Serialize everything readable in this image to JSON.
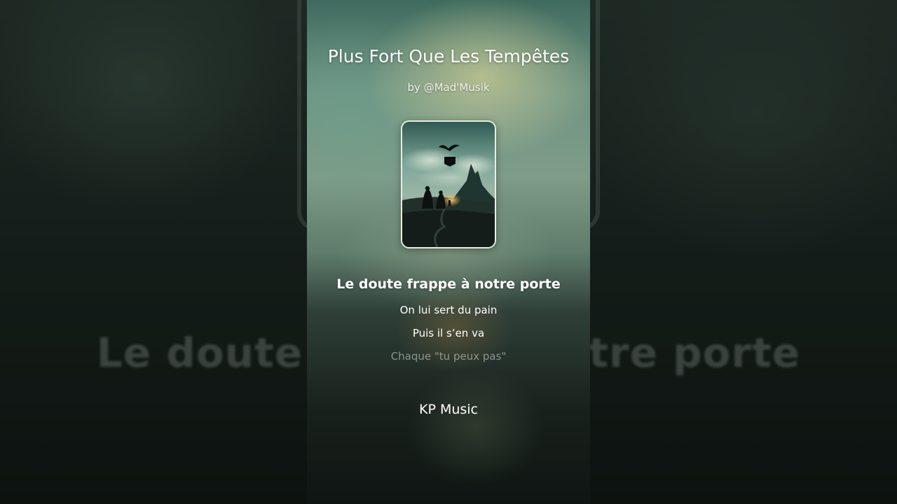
{
  "song": {
    "title": "Plus Fort Que Les Tempêtes",
    "artist": "by @Mad'Musik"
  },
  "cover": {
    "icon": "album-cover-art"
  },
  "lyrics": {
    "current": "Le doute frappe à notre porte",
    "upcoming": [
      "On lui sert du pain",
      "Puis il s’en va",
      "Chaque \"tu peux pas\""
    ]
  },
  "background": {
    "blurred_lyric": "Le doute frappe à notre porte"
  },
  "channel": {
    "name": "KP Music"
  }
}
